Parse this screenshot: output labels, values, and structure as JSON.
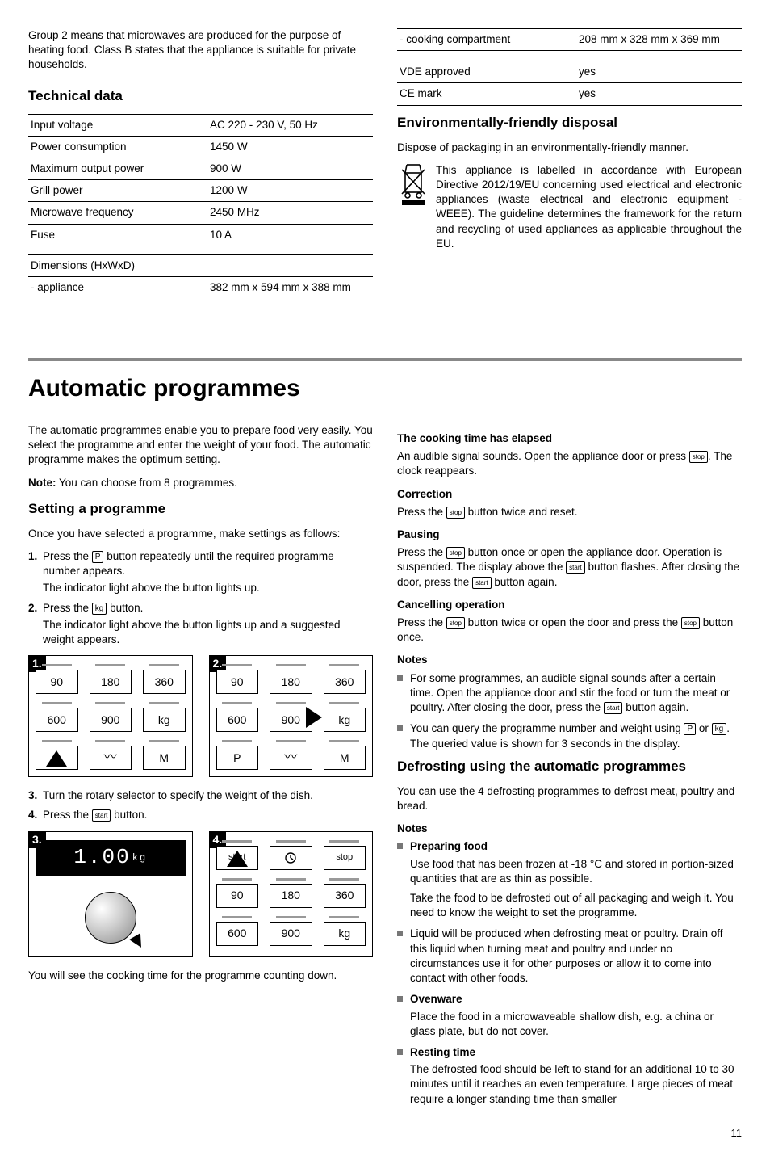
{
  "top_left": {
    "intro": "Group 2 means that microwaves are produced for the purpose of heating food. Class B states that the appliance is suitable for private households.",
    "heading": "Technical data",
    "specs": [
      {
        "label": "Input voltage",
        "value": "AC 220 - 230 V, 50 Hz"
      },
      {
        "label": "Power consumption",
        "value": "1450 W"
      },
      {
        "label": "Maximum output power",
        "value": "900 W"
      },
      {
        "label": "Grill power",
        "value": "1200 W"
      },
      {
        "label": "Microwave frequency",
        "value": "2450 MHz"
      },
      {
        "label": "Fuse",
        "value": "10 A"
      }
    ],
    "dims_label": "Dimensions (HxWxD)",
    "dims_appliance_label": "- appliance",
    "dims_appliance_value": "382 mm x 594 mm x 388 mm"
  },
  "top_right": {
    "cooking_comp_label": "- cooking compartment",
    "cooking_comp_value": "208 mm x 328 mm x 369 mm",
    "approvals": [
      {
        "label": "VDE approved",
        "value": "yes"
      },
      {
        "label": "CE mark",
        "value": "yes"
      }
    ],
    "env_heading": "Environmentally-friendly disposal",
    "env_intro": "Dispose of packaging in an environmentally-friendly manner.",
    "weee_text": "This appliance is labelled in accordance with European Directive 2012/19/EU concerning used electrical and electronic appliances (waste electrical and electronic equipment - WEEE). The guideline determines the framework for the return and recycling of used appliances as applicable throughout the EU."
  },
  "main_heading": "Automatic programmes",
  "auto_left": {
    "intro": "The automatic programmes enable you to prepare food very easily. You select the programme and enter the weight of your food. The automatic programme makes the optimum setting.",
    "note_label": "Note:",
    "note_text": " You can choose from 8 programmes.",
    "setting_heading": "Setting a programme",
    "setting_intro": "Once you have selected a programme, make settings as follows:",
    "step1_num": "1.",
    "step1_a": "Press the ",
    "step1_btn": "P",
    "step1_b": " button repeatedly until the required programme number appears.",
    "step1_sub": "The indicator light above the button lights up.",
    "step2_num": "2.",
    "step2_a": "Press the ",
    "step2_btn": "kg",
    "step2_b": " button.",
    "step2_sub": "The indicator light above the button lights up and a suggested weight appears.",
    "step3_num": "3.",
    "step3_text": "Turn the rotary selector to specify the weight of the dish.",
    "step4_num": "4.",
    "step4_a": "Press the ",
    "step4_btn": "start",
    "step4_b": " button.",
    "panel_buttons": {
      "b90": "90",
      "b180": "180",
      "b360": "360",
      "b600": "600",
      "b900": "900",
      "kg": "kg",
      "p": "P",
      "m": "M",
      "start": "start",
      "stop": "stop",
      "wave": "〰"
    },
    "display_value": "1.00",
    "display_unit": "kg",
    "countdown_text": "You will see the cooking time for the programme counting down."
  },
  "auto_right": {
    "elapsed_heading": "The cooking time has elapsed",
    "elapsed_a": "An audible signal sounds. Open the appliance door or press ",
    "elapsed_btn": "stop",
    "elapsed_b": ". The clock reappears.",
    "correction_heading": "Correction",
    "correction_a": "Press the ",
    "correction_btn": "stop",
    "correction_b": " button twice and reset.",
    "pausing_heading": "Pausing",
    "pausing_a": "Press the ",
    "pausing_btn1": "stop",
    "pausing_b": " button once or open the appliance door. Operation is suspended. The display above the  ",
    "pausing_btn2": "start",
    "pausing_c": " button flashes. After closing the door, press the  ",
    "pausing_btn3": "start",
    "pausing_d": " button again.",
    "cancel_heading": "Cancelling operation",
    "cancel_a": "Press the ",
    "cancel_btn1": "stop",
    "cancel_b": " button twice or open the door and press the ",
    "cancel_btn2": "stop",
    "cancel_c": " button once.",
    "notes_heading": "Notes",
    "note1_a": "For some programmes, an audible signal sounds after a certain time. Open the appliance door and stir the food or turn the meat or poultry. After closing the door, press the ",
    "note1_btn": "start",
    "note1_b": " button again.",
    "note2_a": "You can query the programme number and weight using ",
    "note2_btn1": "P",
    "note2_b": " or ",
    "note2_btn2": "kg",
    "note2_c": ". The queried value is shown for 3 seconds in the display.",
    "defrost_heading": "Defrosting using the automatic programmes",
    "defrost_intro": "You can use the 4 defrosting programmes to defrost meat, poultry and bread.",
    "defrost_notes_heading": "Notes",
    "prep_heading": "Preparing food",
    "prep_p1": "Use food that has been frozen at -18 °C and stored in portion-sized quantities that are as thin as possible.",
    "prep_p2": "Take the food to be defrosted out of all packaging and weigh it. You need to know the weight to set the programme.",
    "liquid_text": "Liquid will be produced when defrosting meat or poultry. Drain off this liquid when turning meat and poultry and under no circumstances use it for other purposes or allow it to come into contact with other foods.",
    "ovenware_heading": "Ovenware",
    "ovenware_text": "Place the food in a microwaveable shallow dish, e.g. a china or glass plate, but do not cover.",
    "resting_heading": "Resting time",
    "resting_text": "The defrosted food should be left to stand for an additional 10 to 30 minutes until it reaches an even temperature. Large pieces of meat require a longer standing time than smaller"
  },
  "page_num": "11"
}
